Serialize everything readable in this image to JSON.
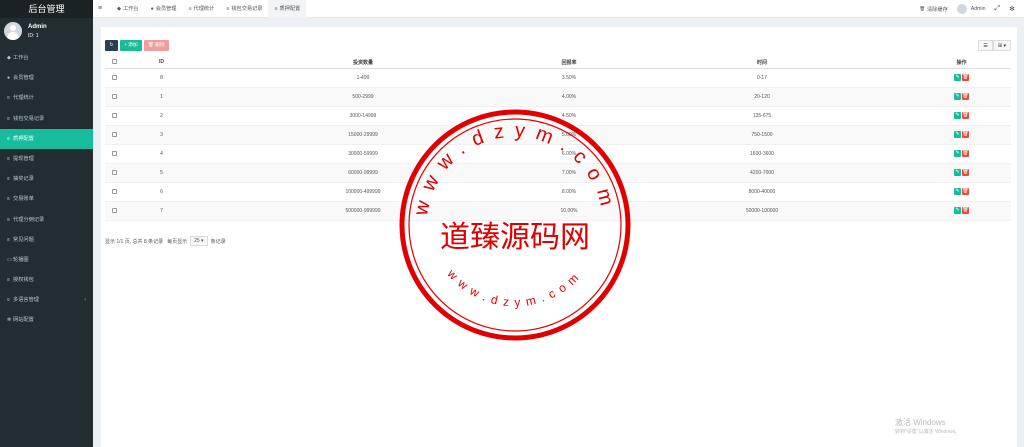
{
  "app": {
    "title": "后台管理"
  },
  "user": {
    "name": "Admin",
    "id_text": "ID: 1"
  },
  "sidebar": {
    "items": [
      {
        "label": "工作台",
        "icon": "dashboard-icon",
        "glyph": "◆"
      },
      {
        "label": "会员管理",
        "icon": "user-icon",
        "glyph": "●"
      },
      {
        "label": "代理统计",
        "icon": "list-icon",
        "glyph": "≡"
      },
      {
        "label": "钱包交易记录",
        "icon": "list-icon",
        "glyph": "≡"
      },
      {
        "label": "质押配置",
        "icon": "list-icon",
        "glyph": "≡"
      },
      {
        "label": "提现管理",
        "icon": "list-icon",
        "glyph": "≡"
      },
      {
        "label": "抽奖记录",
        "icon": "list-icon",
        "glyph": "≡"
      },
      {
        "label": "交易账单",
        "icon": "list-icon",
        "glyph": "≡"
      },
      {
        "label": "代理分佣记录",
        "icon": "list-icon",
        "glyph": "≡"
      },
      {
        "label": "常见问题",
        "icon": "list-icon",
        "glyph": "≡"
      },
      {
        "label": "轮播图",
        "icon": "image-icon",
        "glyph": "▭"
      },
      {
        "label": "授权钱包",
        "icon": "list-icon",
        "glyph": "≡"
      },
      {
        "label": "多语言管理",
        "icon": "list-icon",
        "glyph": "≡"
      },
      {
        "label": "网站配置",
        "icon": "gear-icon",
        "glyph": "✻"
      }
    ],
    "active_index": 4,
    "submenu_arrow": "‹"
  },
  "topnav": {
    "toggle_glyph": "≡",
    "tabs": [
      {
        "label": "工作台",
        "glyph": "◆"
      },
      {
        "label": "会员管理",
        "glyph": "●"
      },
      {
        "label": "代理统计",
        "glyph": "≡"
      },
      {
        "label": "钱包交易记录",
        "glyph": "≡"
      },
      {
        "label": "质押配置",
        "glyph": "≡"
      }
    ],
    "active_tab": 4,
    "clear_cache": "清除缓存",
    "clear_cache_glyph": "🗑",
    "user_label": "Admin",
    "fullscreen_glyph": "⤢",
    "settings_glyph": "✻"
  },
  "toolbar": {
    "refresh_glyph": "↻",
    "add_label": "+ 添加",
    "delete_label": "🗑 删除",
    "view_list_glyph": "☰",
    "view_grid_glyph": "⊞ ▾"
  },
  "table": {
    "headers": [
      "",
      "ID",
      "投资数量",
      "回报率",
      "时间",
      "操作"
    ],
    "rows": [
      {
        "id": "8",
        "amount": "1-499",
        "rate": "3.50%",
        "time": "0-17"
      },
      {
        "id": "1",
        "amount": "500-2999",
        "rate": "4.00%",
        "time": "20-120"
      },
      {
        "id": "2",
        "amount": "3000-14999",
        "rate": "4.50%",
        "time": "135-675"
      },
      {
        "id": "3",
        "amount": "15000-29999",
        "rate": "5.00%",
        "time": "750-1500"
      },
      {
        "id": "4",
        "amount": "30000-59999",
        "rate": "6.00%",
        "time": "1600-3600"
      },
      {
        "id": "5",
        "amount": "60000-99999",
        "rate": "7.00%",
        "time": "4200-7000"
      },
      {
        "id": "6",
        "amount": "100000-499999",
        "rate": "8.00%",
        "time": "8000-40000"
      },
      {
        "id": "7",
        "amount": "500000-999999",
        "rate": "10.00%",
        "time": "50000-100000"
      }
    ],
    "edit_glyph": "✎",
    "delete_glyph": "🗑"
  },
  "pager": {
    "summary": "显示 1/1 页, 总共 8 条记录",
    "per_page_label": "每页显示",
    "page_size": "25 ▾",
    "records_label": "条记录"
  },
  "watermark": {
    "name": "道臻源码网",
    "url_top": "www.dzym.com",
    "url_bottom": "www.dzym.com",
    "color": "#e00000"
  },
  "windows": {
    "activate_title": "激活 Windows",
    "activate_sub": "转到\"设置\"以激活 Windows。"
  }
}
